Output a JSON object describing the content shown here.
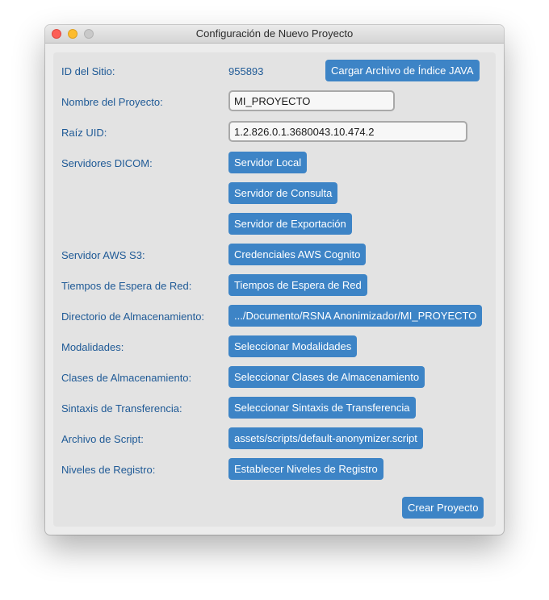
{
  "window": {
    "title": "Configuración de Nuevo Proyecto"
  },
  "site": {
    "label": "ID del Sitio:",
    "value": "955893",
    "load_button": "Cargar Archivo de Índice JAVA"
  },
  "project_name": {
    "label": "Nombre del Proyecto:",
    "value": "MI_PROYECTO"
  },
  "uid_root": {
    "label": "Raíz UID:",
    "value": "1.2.826.0.1.3680043.10.474.2"
  },
  "dicom": {
    "label": "Servidores DICOM:",
    "local_button": "Servidor Local",
    "query_button": "Servidor de Consulta",
    "export_button": "Servidor de Exportación"
  },
  "aws": {
    "label": "Servidor AWS S3:",
    "button": "Credenciales AWS Cognito"
  },
  "network": {
    "label": "Tiempos de Espera de Red:",
    "button": "Tiempos de Espera de Red"
  },
  "storage_dir": {
    "label": "Directorio de Almacenamiento:",
    "button": ".../Documento/RSNA Anonimizador/MI_PROYECTO"
  },
  "modalities": {
    "label": "Modalidades:",
    "button": "Seleccionar Modalidades"
  },
  "storage_classes": {
    "label": "Clases de Almacenamiento:",
    "button": "Seleccionar Clases de Almacenamiento"
  },
  "transfer_syntax": {
    "label": "Sintaxis de Transferencia:",
    "button": "Seleccionar Sintaxis de Transferencia"
  },
  "script_file": {
    "label": "Archivo de Script:",
    "button": "assets/scripts/default-anonymizer.script"
  },
  "log_levels": {
    "label": "Niveles de Registro:",
    "button": "Establecer Niveles de Registro"
  },
  "footer": {
    "create_button": "Crear Proyecto"
  },
  "colors": {
    "accent": "#3d84c6",
    "label_text": "#1f5a96"
  }
}
